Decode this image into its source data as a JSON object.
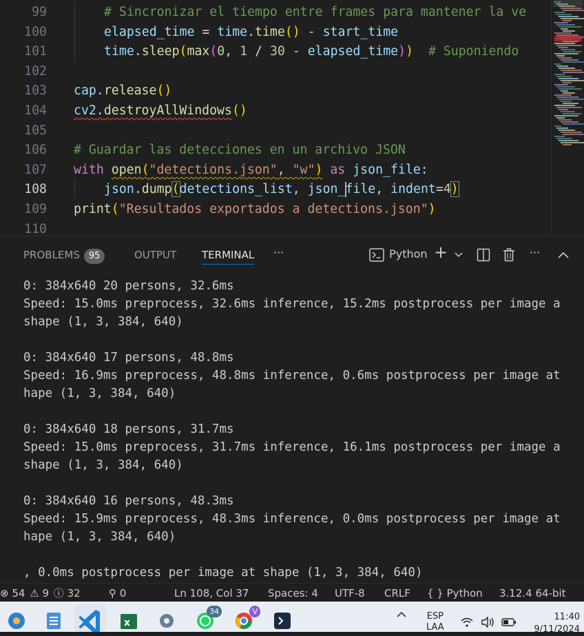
{
  "editor": {
    "lines": [
      {
        "num": "99",
        "indent": 2,
        "tokens": [
          [
            "cmt",
            "# Sincronizar el tiempo entre frames para mantener la ve"
          ]
        ]
      },
      {
        "num": "100",
        "indent": 2,
        "tokens": [
          [
            "var",
            "elapsed_time"
          ],
          [
            "op",
            " = "
          ],
          [
            "var",
            "time"
          ],
          [
            "op",
            "."
          ],
          [
            "fn",
            "time"
          ],
          [
            "br1",
            "()"
          ],
          [
            "op",
            " - "
          ],
          [
            "var",
            "start_time"
          ]
        ]
      },
      {
        "num": "101",
        "indent": 2,
        "tokens": [
          [
            "var",
            "time"
          ],
          [
            "op",
            "."
          ],
          [
            "fn",
            "sleep"
          ],
          [
            "br1",
            "("
          ],
          [
            "fn",
            "max"
          ],
          [
            "br2",
            "("
          ],
          [
            "num",
            "0"
          ],
          [
            "op",
            ", "
          ],
          [
            "num",
            "1"
          ],
          [
            "op",
            " / "
          ],
          [
            "num",
            "30"
          ],
          [
            "op",
            " - "
          ],
          [
            "var",
            "elapsed_time"
          ],
          [
            "br2",
            ")"
          ],
          [
            "br1",
            ")"
          ],
          [
            "op",
            "  "
          ],
          [
            "cmt",
            "# Suponiendo"
          ]
        ]
      },
      {
        "num": "102",
        "indent": 0,
        "tokens": []
      },
      {
        "num": "103",
        "indent": 0,
        "tokens": [
          [
            "var",
            "cap"
          ],
          [
            "op",
            "."
          ],
          [
            "fn",
            "release"
          ],
          [
            "br1",
            "()"
          ]
        ]
      },
      {
        "num": "104",
        "indent": 0,
        "tokens": [
          [
            "var",
            "cv2",
            "squig"
          ],
          [
            "op",
            ".",
            "squig"
          ],
          [
            "fn",
            "destroyAllWindows",
            "squig"
          ],
          [
            "br1",
            "()"
          ]
        ]
      },
      {
        "num": "105",
        "indent": 0,
        "tokens": []
      },
      {
        "num": "106",
        "indent": 0,
        "tokens": [
          [
            "cmt",
            "# Guardar las detecciones en un archivo JSON"
          ]
        ]
      },
      {
        "num": "107",
        "indent": 0,
        "tokens": [
          [
            "kw",
            "with"
          ],
          [
            "op",
            " "
          ],
          [
            "fn",
            "open",
            "squigy"
          ],
          [
            "br1",
            "(",
            "squigy"
          ],
          [
            "str",
            "\"detections.json\"",
            "squigy"
          ],
          [
            "op",
            ", ",
            "squigy"
          ],
          [
            "str",
            "\"w\"",
            "squigy"
          ],
          [
            "br1",
            ")",
            "squigy"
          ],
          [
            "op",
            " "
          ],
          [
            "kw",
            "as"
          ],
          [
            "op",
            " "
          ],
          [
            "var",
            "json_file"
          ],
          [
            "op",
            ":"
          ]
        ]
      },
      {
        "num": "108",
        "indent": 2,
        "active": true,
        "tokens": [
          [
            "var",
            "json"
          ],
          [
            "op",
            "."
          ],
          [
            "fn",
            "dump"
          ],
          [
            "br1",
            "(",
            "box"
          ],
          [
            "var",
            "detections_list"
          ],
          [
            "op",
            ", "
          ],
          [
            "var",
            "json_"
          ],
          [
            "cursor",
            ""
          ],
          [
            "var",
            "file"
          ],
          [
            "op",
            ", "
          ],
          [
            "var",
            "indent"
          ],
          [
            "op",
            "="
          ],
          [
            "num",
            "4"
          ],
          [
            "br1",
            ")",
            "box"
          ]
        ]
      },
      {
        "num": "109",
        "indent": 0,
        "tokens": [
          [
            "fn",
            "print"
          ],
          [
            "br1",
            "("
          ],
          [
            "str",
            "\"Resultados exportados a detections.json\""
          ],
          [
            "br1",
            ")"
          ]
        ]
      },
      {
        "num": "110",
        "indent": 0,
        "tokens": []
      }
    ]
  },
  "panel": {
    "tabs": [
      {
        "label": "PROBLEMS",
        "badge": "95"
      },
      {
        "label": "OUTPUT"
      },
      {
        "label": "TERMINAL",
        "active": true
      }
    ],
    "more_label": "···",
    "shell_label": "Python",
    "add_label": "+",
    "ellipsis_label": "···"
  },
  "terminal": {
    "lines": [
      "0: 384x640 20 persons, 32.6ms",
      "Speed: 15.0ms preprocess, 32.6ms inference, 15.2ms postprocess per image a",
      "shape (1, 3, 384, 640)",
      "",
      "0: 384x640 17 persons, 48.8ms",
      "Speed: 16.9ms preprocess, 48.8ms inference, 0.6ms postprocess per image at",
      "hape (1, 3, 384, 640)",
      "",
      "0: 384x640 18 persons, 31.7ms",
      "Speed: 15.0ms preprocess, 31.7ms inference, 16.1ms postprocess per image a",
      "shape (1, 3, 384, 640)",
      "",
      "0: 384x640 16 persons, 48.3ms",
      "Speed: 15.9ms preprocess, 48.3ms inference, 0.0ms postprocess per image at",
      "hape (1, 3, 384, 640)",
      "",
      ", 0.0ms postprocess per image at shape (1, 3, 384, 640)"
    ]
  },
  "status": {
    "errors": "54",
    "warnings": "9",
    "infos": "32",
    "ports": "0",
    "position": "Ln 108, Col 37",
    "spaces": "Spaces: 4",
    "encoding": "UTF-8",
    "eol": "CRLF",
    "language": "Python",
    "language_prefix": "{ }",
    "interpreter": "3.12.4 64-bit"
  },
  "taskbar": {
    "whatsapp_badge": "34",
    "chrome_badge": "V",
    "lang_top": "ESP",
    "lang_bottom": "LAA",
    "time": "11:40",
    "date": "9/11/2024"
  },
  "colors": {
    "editor_bg": "#1f1f1f",
    "accent": "#0078d4",
    "error": "#f14c4c",
    "warning": "#cca700"
  }
}
